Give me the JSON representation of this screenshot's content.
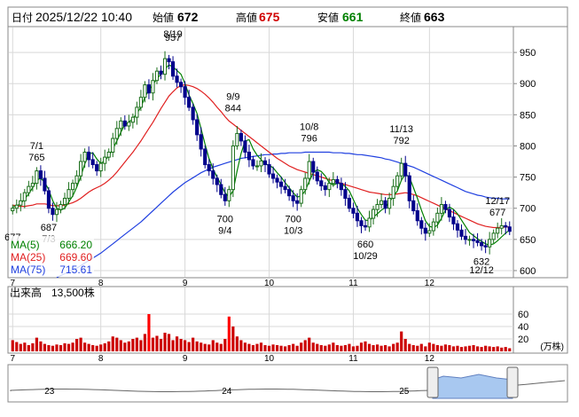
{
  "header": {
    "date_label": "日付",
    "datetime": "2025/12/22 10:40",
    "open_label": "始値",
    "open": "672",
    "high_label": "高値",
    "high": "675",
    "low_label": "安値",
    "low": "661",
    "close_label": "終値",
    "close": "663"
  },
  "colors": {
    "up_fill": "#ffffff",
    "up_stroke": "#1a6e1a",
    "down_fill": "#00008b",
    "ma5": "#008000",
    "ma25": "#e02020",
    "ma75": "#2040e0",
    "volume": "#cc0000",
    "volume_spike": "#ff0000",
    "nav_fill": "#a8c8f0"
  },
  "chart_data": [
    {
      "type": "candlestick",
      "ylim": [
        590,
        990
      ],
      "y_ticks": [
        600,
        650,
        700,
        750,
        800,
        850,
        900,
        950
      ],
      "x_ticks": [
        {
          "label": "7",
          "index": 0
        },
        {
          "label": "8",
          "index": 22
        },
        {
          "label": "9",
          "index": 43
        },
        {
          "label": "10",
          "index": 64
        },
        {
          "label": "11",
          "index": 85
        },
        {
          "label": "12",
          "index": 104
        }
      ],
      "legend": [
        {
          "name": "MA(5)",
          "value": "666.20",
          "color": "#008000"
        },
        {
          "name": "MA(25)",
          "value": "669.60",
          "color": "#e02020"
        },
        {
          "name": "MA(75)",
          "value": "715.61",
          "color": "#2040e0"
        }
      ],
      "annotations": [
        {
          "label": "677",
          "index": 0,
          "value": 677,
          "pos": "below"
        },
        {
          "label": "7/1",
          "index": 6,
          "value": 765,
          "pos": "above-date"
        },
        {
          "label": "765",
          "index": 6,
          "value": 765,
          "pos": "above"
        },
        {
          "label": "687",
          "index": 9,
          "value": 687,
          "pos": "below-top"
        },
        {
          "label": "7/3",
          "index": 9,
          "value": 687,
          "pos": "below-date"
        },
        {
          "label": "8/19",
          "index": 40,
          "value": 957,
          "pos": "above-date"
        },
        {
          "label": "957",
          "index": 40,
          "value": 957,
          "pos": "above"
        },
        {
          "label": "9/9",
          "index": 55,
          "value": 844,
          "pos": "above-date"
        },
        {
          "label": "844",
          "index": 55,
          "value": 844,
          "pos": "above"
        },
        {
          "label": "700",
          "index": 53,
          "value": 700,
          "pos": "below-top"
        },
        {
          "label": "9/4",
          "index": 53,
          "value": 700,
          "pos": "below-date"
        },
        {
          "label": "10/8",
          "index": 74,
          "value": 796,
          "pos": "above-date"
        },
        {
          "label": "796",
          "index": 74,
          "value": 796,
          "pos": "above"
        },
        {
          "label": "700",
          "index": 70,
          "value": 700,
          "pos": "below-top"
        },
        {
          "label": "10/3",
          "index": 70,
          "value": 700,
          "pos": "below-date"
        },
        {
          "label": "11/13",
          "index": 97,
          "value": 792,
          "pos": "above-date"
        },
        {
          "label": "792",
          "index": 97,
          "value": 792,
          "pos": "above"
        },
        {
          "label": "660",
          "index": 88,
          "value": 660,
          "pos": "below-top"
        },
        {
          "label": "10/29",
          "index": 88,
          "value": 660,
          "pos": "below-date"
        },
        {
          "label": "12/17",
          "index": 121,
          "value": 677,
          "pos": "above-date"
        },
        {
          "label": "677",
          "index": 121,
          "value": 677,
          "pos": "above"
        },
        {
          "label": "632",
          "index": 117,
          "value": 632,
          "pos": "below-top"
        },
        {
          "label": "12/12",
          "index": 117,
          "value": 632,
          "pos": "below-date"
        }
      ],
      "close": [
        700,
        705,
        712,
        725,
        735,
        740,
        760,
        748,
        728,
        700,
        690,
        698,
        706,
        716,
        730,
        740,
        752,
        775,
        790,
        778,
        770,
        760,
        772,
        782,
        790,
        812,
        828,
        840,
        832,
        838,
        846,
        862,
        878,
        898,
        885,
        905,
        920,
        915,
        940,
        935,
        912,
        902,
        895,
        878,
        862,
        842,
        818,
        795,
        770,
        760,
        748,
        738,
        722,
        712,
        730,
        800,
        820,
        808,
        790,
        778,
        768,
        768,
        776,
        770,
        755,
        748,
        742,
        735,
        730,
        720,
        712,
        708,
        730,
        748,
        775,
        758,
        744,
        736,
        730,
        740,
        746,
        740,
        730,
        716,
        700,
        692,
        680,
        672,
        670,
        684,
        698,
        706,
        712,
        700,
        716,
        735,
        752,
        772,
        752,
        712,
        696,
        680,
        668,
        660,
        664,
        678,
        692,
        706,
        698,
        686,
        675,
        665,
        655,
        650,
        650,
        648,
        645,
        640,
        638,
        650,
        660,
        668,
        672,
        670,
        663
      ],
      "ma5": [
        702,
        704,
        707,
        715,
        723,
        733,
        745,
        748,
        742,
        730,
        712,
        700,
        697,
        700,
        710,
        720,
        734,
        751,
        771,
        787,
        789,
        779,
        772,
        776,
        784,
        795,
        808,
        822,
        834,
        838,
        844,
        852,
        862,
        878,
        890,
        898,
        908,
        915,
        923,
        930,
        927,
        921,
        915,
        900,
        882,
        868,
        852,
        828,
        803,
        780,
        763,
        750,
        738,
        725,
        718,
        728,
        760,
        788,
        808,
        810,
        795,
        785,
        778,
        771,
        769,
        765,
        757,
        750,
        741,
        733,
        725,
        718,
        720,
        728,
        743,
        757,
        762,
        759,
        752,
        741,
        737,
        740,
        739,
        735,
        728,
        714,
        700,
        690,
        681,
        680,
        686,
        691,
        697,
        701,
        710,
        719,
        728,
        745,
        755,
        750,
        733,
        716,
        697,
        680,
        671,
        669,
        673,
        684,
        697,
        702,
        698,
        691,
        681,
        671,
        661,
        656,
        651,
        647,
        643,
        641,
        643,
        648,
        654,
        660,
        665
      ],
      "ma25": [
        705,
        704,
        703,
        703,
        704,
        705,
        707,
        707,
        707,
        706,
        704,
        704,
        704,
        705,
        707,
        709,
        712,
        716,
        721,
        726,
        730,
        733,
        736,
        740,
        745,
        751,
        758,
        766,
        774,
        782,
        790,
        799,
        808,
        818,
        828,
        838,
        849,
        860,
        870,
        880,
        887,
        893,
        897,
        898,
        897,
        895,
        892,
        888,
        883,
        877,
        870,
        862,
        855,
        847,
        840,
        835,
        830,
        825,
        820,
        815,
        810,
        805,
        800,
        795,
        790,
        785,
        780,
        776,
        772,
        768,
        765,
        762,
        760,
        758,
        756,
        754,
        752,
        750,
        748,
        746,
        744,
        742,
        740,
        738,
        736,
        734,
        732,
        730,
        728,
        726,
        725,
        724,
        723,
        722,
        722,
        722,
        723,
        724,
        725,
        724,
        722,
        720,
        717,
        714,
        711,
        708,
        705,
        702,
        699,
        696,
        693,
        690,
        687,
        684,
        681,
        678,
        675,
        673,
        671,
        670,
        669,
        669,
        669,
        670,
        670
      ],
      "ma75": [
        560,
        562,
        564,
        566,
        568,
        571,
        574,
        577,
        580,
        583,
        586,
        589,
        592,
        595,
        598,
        601,
        604,
        608,
        612,
        616,
        620,
        624,
        628,
        633,
        638,
        643,
        648,
        653,
        658,
        663,
        668,
        673,
        678,
        684,
        690,
        696,
        702,
        708,
        714,
        720,
        726,
        731,
        736,
        741,
        745,
        749,
        753,
        757,
        760,
        763,
        766,
        768,
        770,
        772,
        774,
        776,
        778,
        780,
        781,
        782,
        783,
        784,
        785,
        786,
        786,
        787,
        787,
        788,
        788,
        789,
        789,
        789,
        789,
        790,
        790,
        790,
        790,
        790,
        790,
        790,
        789,
        789,
        789,
        788,
        788,
        787,
        786,
        786,
        785,
        784,
        783,
        782,
        781,
        779,
        778,
        776,
        774,
        772,
        770,
        768,
        766,
        763,
        760,
        757,
        754,
        751,
        748,
        745,
        742,
        739,
        736,
        733,
        730,
        727,
        725,
        723,
        721,
        720,
        718,
        717,
        716,
        716,
        715,
        715,
        715
      ]
    },
    {
      "type": "bar",
      "title": "出来高",
      "subtitle": "13,500株",
      "unit_label": "(万株)",
      "ylim": [
        0,
        80
      ],
      "y_ticks": [
        20,
        40,
        60
      ],
      "values": [
        18,
        15,
        12,
        14,
        10,
        13,
        22,
        16,
        12,
        10,
        9,
        11,
        10,
        13,
        12,
        14,
        20,
        22,
        14,
        12,
        10,
        9,
        11,
        13,
        16,
        24,
        22,
        18,
        14,
        16,
        20,
        22,
        18,
        28,
        60,
        22,
        25,
        20,
        30,
        28,
        18,
        24,
        20,
        18,
        15,
        22,
        16,
        14,
        12,
        11,
        18,
        14,
        12,
        20,
        56,
        40,
        24,
        18,
        14,
        12,
        10,
        12,
        14,
        10,
        9,
        11,
        10,
        9,
        8,
        10,
        12,
        9,
        14,
        18,
        22,
        14,
        12,
        10,
        9,
        11,
        14,
        10,
        9,
        10,
        12,
        8,
        9,
        14,
        16,
        12,
        10,
        11,
        9,
        10,
        8,
        12,
        14,
        32,
        20,
        12,
        10,
        9,
        12,
        8,
        14,
        12,
        10,
        9,
        11,
        10,
        8,
        9,
        7,
        8,
        9,
        10,
        8,
        7,
        9,
        8,
        7,
        8,
        6,
        7,
        5
      ]
    }
  ],
  "x_labels_volume": [
    "7",
    "8",
    "9",
    "10",
    "11",
    "12"
  ],
  "navigator": {
    "labels": [
      {
        "label": "23",
        "pos": 0.07
      },
      {
        "label": "24",
        "pos": 0.39
      },
      {
        "label": "25",
        "pos": 0.71
      }
    ]
  }
}
